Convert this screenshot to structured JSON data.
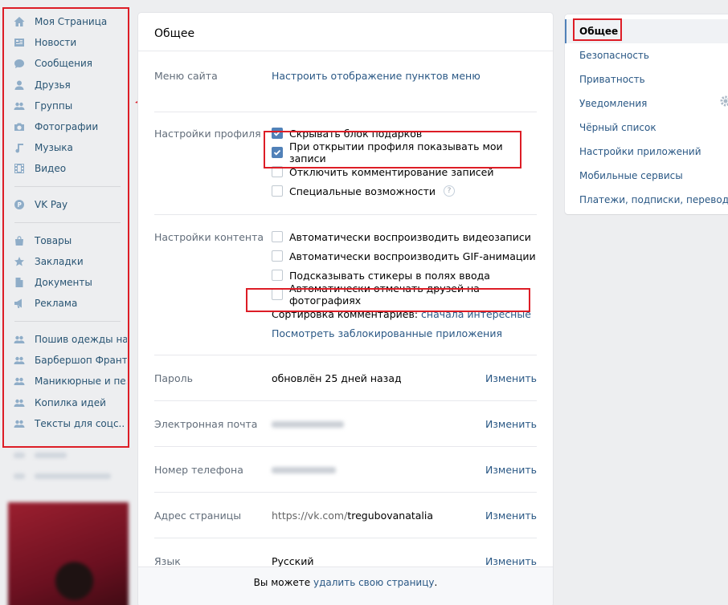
{
  "sidebar": {
    "items_top": [
      {
        "label": "Моя Страница",
        "icon": "home-icon"
      },
      {
        "label": "Новости",
        "icon": "news-icon"
      },
      {
        "label": "Сообщения",
        "icon": "messages-icon"
      },
      {
        "label": "Друзья",
        "icon": "user-icon"
      },
      {
        "label": "Группы",
        "icon": "group-icon"
      },
      {
        "label": "Фотографии",
        "icon": "camera-icon"
      },
      {
        "label": "Музыка",
        "icon": "music-icon"
      },
      {
        "label": "Видео",
        "icon": "video-icon"
      }
    ],
    "vkpay": {
      "label": "VK Pay",
      "icon": "vkpay-icon"
    },
    "items_mid": [
      {
        "label": "Товары",
        "icon": "bag-icon"
      },
      {
        "label": "Закладки",
        "icon": "star-icon"
      },
      {
        "label": "Документы",
        "icon": "document-icon"
      },
      {
        "label": "Реклама",
        "icon": "megaphone-icon"
      }
    ],
    "groups": [
      {
        "label": "Пошив одежды на.."
      },
      {
        "label": "Барбершоп Франт.."
      },
      {
        "label": "Маникюрные и пе.."
      },
      {
        "label": "Копилка идей"
      },
      {
        "label": "Тексты для соцс.."
      }
    ]
  },
  "main": {
    "title": "Общее",
    "site_menu": {
      "label": "Меню сайта",
      "link": "Настроить отображение пунктов меню"
    },
    "profile": {
      "label": "Настройки профиля",
      "options": [
        {
          "text": "Скрывать блок подарков",
          "checked": true
        },
        {
          "text": "При открытии профиля показывать мои записи",
          "checked": true
        },
        {
          "text": "Отключить комментирование записей",
          "checked": false
        },
        {
          "text": "Специальные возможности",
          "checked": false,
          "help": "?"
        }
      ]
    },
    "content": {
      "label": "Настройки контента",
      "options": [
        {
          "text": "Автоматически воспроизводить видеозаписи",
          "checked": false
        },
        {
          "text": "Автоматически воспроизводить GIF-анимации",
          "checked": false
        },
        {
          "text": "Подсказывать стикеры в полях ввода",
          "checked": false
        },
        {
          "text": "Автоматически отмечать друзей на фотографиях",
          "checked": false
        }
      ],
      "sort_label": "Сортировка комментариев:",
      "sort_value": "сначала интересные",
      "blocked_apps": "Посмотреть заблокированные приложения"
    },
    "password": {
      "label": "Пароль",
      "value": "обновлён 25 дней назад",
      "action": "Изменить"
    },
    "email": {
      "label": "Электронная почта",
      "action": "Изменить"
    },
    "phone": {
      "label": "Номер телефона",
      "action": "Изменить"
    },
    "address": {
      "label": "Адрес страницы",
      "prefix": "https://vk.com/",
      "value": "tregubovanatalia",
      "action": "Изменить"
    },
    "language": {
      "label": "Язык",
      "value": "Русский",
      "action": "Изменить"
    },
    "footer": {
      "text": "Вы можете",
      "link": "удалить свою страницу",
      "end": "."
    }
  },
  "right_menu": {
    "items": [
      {
        "label": "Общее",
        "active": true
      },
      {
        "label": "Безопасность"
      },
      {
        "label": "Приватность"
      },
      {
        "label": "Уведомления"
      },
      {
        "label": "Чёрный список"
      },
      {
        "label": "Настройки приложений"
      },
      {
        "label": "Мобильные сервисы"
      },
      {
        "label": "Платежи, подписки, переводы"
      }
    ]
  },
  "colors": {
    "link": "#2a5885",
    "highlight": "#dd1d26",
    "accent": "#5181b8"
  }
}
